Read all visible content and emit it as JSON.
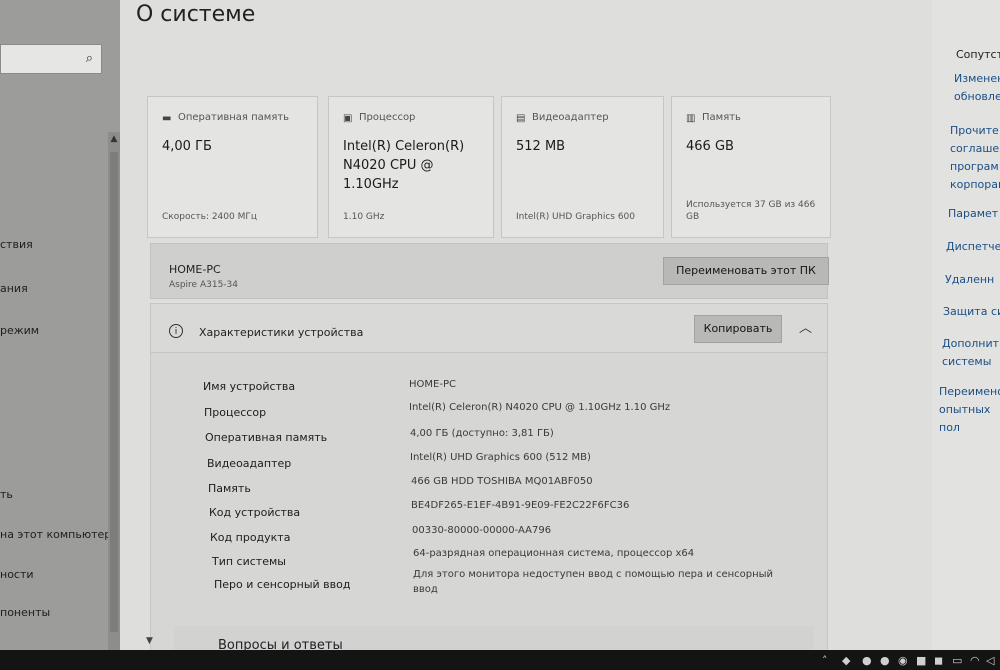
{
  "page": {
    "title": "О системе"
  },
  "left_nav": {
    "items": [
      "ствия",
      "ания",
      "режим",
      "ть",
      "на этот компьютер",
      "ности",
      "поненты"
    ]
  },
  "cards": [
    {
      "icon": "memory-icon",
      "title": "Оперативная память",
      "value": "4,00 ГБ",
      "sub": "Скорость: 2400 МГц"
    },
    {
      "icon": "processor-icon",
      "title": "Процессор",
      "value": "Intel(R) Celeron(R) N4020 CPU @ 1.10GHz",
      "sub": "1.10 GHz"
    },
    {
      "icon": "gpu-icon",
      "title": "Видеоадаптер",
      "value": "512 MB",
      "sub": "Intel(R) UHD Graphics 600"
    },
    {
      "icon": "storage-icon",
      "title": "Память",
      "value": "466 GB",
      "sub": "Используется 37 GB из 466 GB"
    }
  ],
  "pc": {
    "name": "HOME-PC",
    "model": "Aspire A315-34",
    "rename_label": "Переименовать этот ПК"
  },
  "specs": {
    "title": "Характеристики устройства",
    "copy_label": "Копировать",
    "rows": [
      {
        "label": "Имя устройства",
        "value": "HOME-PC"
      },
      {
        "label": "Процессор",
        "value": "Intel(R) Celeron(R) N4020 CPU @ 1.10GHz   1.10 GHz"
      },
      {
        "label": "Оперативная память",
        "value": "4,00 ГБ (доступно: 3,81 ГБ)"
      },
      {
        "label": "Видеоадаптер",
        "value": "Intel(R) UHD Graphics 600 (512 MB)"
      },
      {
        "label": "Память",
        "value": "466 GB HDD TOSHIBA MQ01ABF050"
      },
      {
        "label": "Код устройства",
        "value": "BE4DF265-E1EF-4B91-9E09-FE2C22F6FC36"
      },
      {
        "label": "Код продукта",
        "value": "00330-80000-00000-AA796"
      },
      {
        "label": "Тип системы",
        "value": "64-разрядная операционная система, процессор x64"
      },
      {
        "label": "Перо и сенсорный ввод",
        "value": "Для этого монитора недоступен ввод с помощью пера и сенсорный ввод"
      }
    ]
  },
  "faq": {
    "title": "Вопросы и ответы"
  },
  "related": {
    "heading": "Сопутст",
    "links": [
      "Изменен обновле",
      "Прочите соглашен програм корпорац",
      "Парамет",
      "Диспетчер",
      "Удаленн",
      "Защита си",
      "Дополнит системы",
      "Переименов опытных пол"
    ]
  }
}
